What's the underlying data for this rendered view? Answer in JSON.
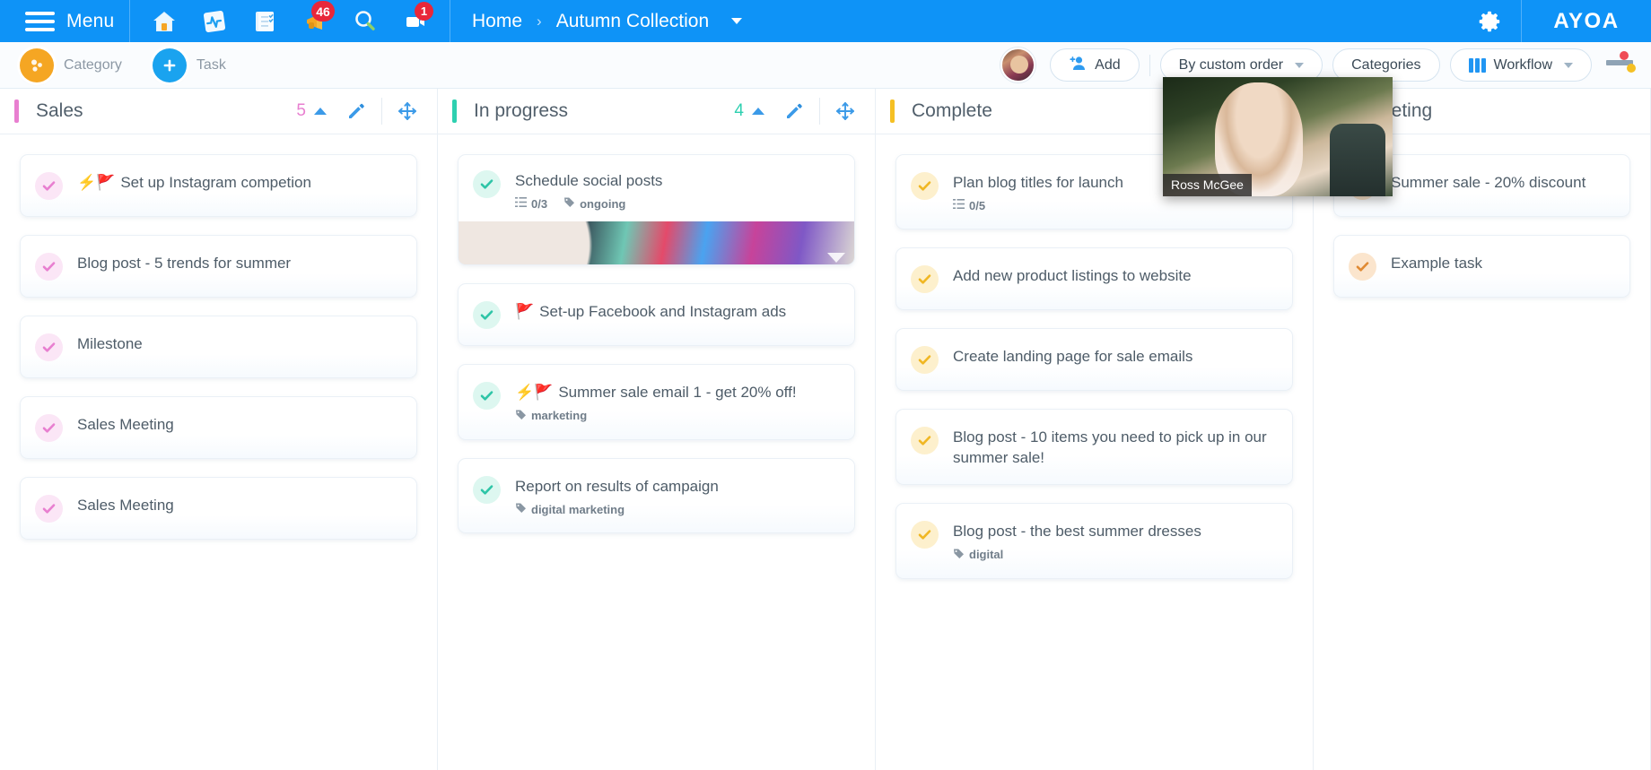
{
  "topbar": {
    "menu_label": "Menu",
    "menu_icon": "hamburger-icon",
    "icons": [
      {
        "name": "home-icon",
        "badge": null
      },
      {
        "name": "activity-pulse-icon",
        "badge": null
      },
      {
        "name": "checklist-notes-icon",
        "badge": null
      },
      {
        "name": "announcement-megaphone-icon",
        "badge": "46"
      },
      {
        "name": "search-icon",
        "badge": null
      },
      {
        "name": "video-camera-icon",
        "badge": "1"
      }
    ],
    "breadcrumb": {
      "home": "Home",
      "separator": "›",
      "current": "Autumn Collection"
    },
    "gear_icon": "gear-icon",
    "brand": "AYOA",
    "brand_color": "#0e93f7"
  },
  "subbar": {
    "category_label": "Category",
    "task_label": "Task",
    "add_label": "Add",
    "sort_label": "By custom order",
    "categories_label": "Categories",
    "workflow_label": "Workflow"
  },
  "board": {
    "columns": [
      {
        "title": "Sales",
        "count": "5",
        "accent": "#e87fd0",
        "check_color": "#f2a4dd",
        "cards": [
          {
            "emoji": "⚡🚩",
            "title": "Set up Instagram competion",
            "checklist": null,
            "tag": null,
            "photo": false
          },
          {
            "emoji": "",
            "title": "Blog post - 5 trends for summer",
            "checklist": null,
            "tag": null,
            "photo": false
          },
          {
            "emoji": "",
            "title": "Milestone",
            "checklist": null,
            "tag": null,
            "photo": false
          },
          {
            "emoji": "",
            "title": "Sales Meeting",
            "checklist": null,
            "tag": null,
            "photo": false
          },
          {
            "emoji": "",
            "title": "Sales Meeting",
            "checklist": null,
            "tag": null,
            "photo": false
          }
        ]
      },
      {
        "title": "In progress",
        "count": "4",
        "accent": "#2ed0b0",
        "check_color": "#5fd8bf",
        "cards": [
          {
            "emoji": "",
            "title": "Schedule social posts",
            "checklist": "0/3",
            "tag": "ongoing",
            "photo": true
          },
          {
            "emoji": "🚩",
            "title": "Set-up Facebook and Instagram ads",
            "checklist": null,
            "tag": null,
            "photo": false
          },
          {
            "emoji": "⚡🚩",
            "title": "Summer sale email 1 - get 20% off!",
            "checklist": null,
            "tag": "marketing",
            "photo": false
          },
          {
            "emoji": "",
            "title": "Report on results of campaign",
            "checklist": null,
            "tag": "digital marketing",
            "photo": false
          }
        ]
      },
      {
        "title": "Complete",
        "count": "",
        "accent": "#f5c024",
        "check_color": "#f7cf57",
        "cards": [
          {
            "emoji": "",
            "title": "Plan blog titles for launch",
            "checklist": "0/5",
            "tag": null,
            "photo": false
          },
          {
            "emoji": "",
            "title": "Add new product listings to website",
            "checklist": null,
            "tag": null,
            "photo": false
          },
          {
            "emoji": "",
            "title": "Create landing page for sale emails",
            "checklist": null,
            "tag": null,
            "photo": false
          },
          {
            "emoji": "",
            "title": "Blog post - 10 items you need to pick up in our summer sale!",
            "checklist": null,
            "tag": null,
            "photo": false
          },
          {
            "emoji": "",
            "title": "Blog post - the best summer dresses",
            "checklist": null,
            "tag": "digital",
            "photo": false
          }
        ]
      },
      {
        "title": "Marketing",
        "count": "",
        "accent": "#f08a24",
        "check_color": "#f3ab5e",
        "cards": [
          {
            "emoji": "",
            "title": "Summer sale - 20% discount",
            "checklist": null,
            "tag": null,
            "photo": false
          },
          {
            "emoji": "",
            "title": "Example task",
            "checklist": null,
            "tag": null,
            "photo": false
          }
        ]
      }
    ]
  },
  "video_overlay": {
    "participant_name": "Ross McGee"
  }
}
